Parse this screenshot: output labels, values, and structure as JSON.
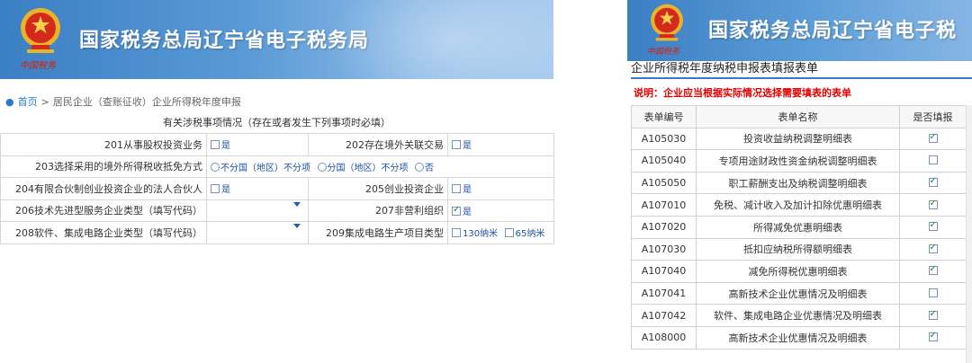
{
  "left": {
    "site_title": "国家税务总局辽宁省电子税务局",
    "calligraphy": "中国税务",
    "breadcrumb": {
      "home": "首页",
      "separator": ">",
      "path": "居民企业（查账征收）企业所得税年度申报"
    },
    "section_title": "有关涉税事项情况（存在或者发生下列事项时必填）",
    "rows": [
      {
        "l1": "201从事股权投资业务",
        "v1": "是",
        "l2": "202存在境外关联交易",
        "v2": "是"
      },
      {
        "l1": "203选择采用的境外所得税收抵免方式",
        "opt1": "不分国（地区）不分项",
        "opt2": "分国（地区）不分项",
        "opt3": "否"
      },
      {
        "l1": "204有限合伙制创业投资企业的法人合伙人",
        "v1": "是",
        "l2": "205创业投资企业",
        "v2": "是"
      },
      {
        "l1": "206技术先进型服务企业类型（填写代码）",
        "l2": "207非营利组织",
        "v2": "是"
      },
      {
        "l1": "208软件、集成电路企业类型（填写代码）",
        "l2": "209集成电路生产项目类型",
        "v2a": "130纳米",
        "v2b": "65纳米"
      }
    ]
  },
  "right": {
    "site_title": "国家税务总局辽宁省电子税",
    "calligraphy": "中国税务",
    "title": "企业所得税年度纳税申报表填报表单",
    "note": "说明：企业应当根据实际情况选择需要填表的表单",
    "headers": {
      "code": "表单编号",
      "name": "表单名称",
      "fill": "是否填报"
    },
    "rows": [
      {
        "code": "A105030",
        "name": "投资收益纳税调整明细表",
        "checked": true
      },
      {
        "code": "A105040",
        "name": "专项用途财政性资金纳税调整明细表",
        "checked": false
      },
      {
        "code": "A105050",
        "name": "职工薪酬支出及纳税调整明细表",
        "checked": true
      },
      {
        "code": "A107010",
        "name": "免税、减计收入及加计扣除优惠明细表",
        "checked": true
      },
      {
        "code": "A107020",
        "name": "所得减免优惠明细表",
        "checked": true
      },
      {
        "code": "A107030",
        "name": "抵扣应纳税所得额明细表",
        "checked": true
      },
      {
        "code": "A107040",
        "name": "减免所得税优惠明细表",
        "checked": true
      },
      {
        "code": "A107041",
        "name": "高新技术企业优惠情况及明细表",
        "checked": false
      },
      {
        "code": "A107042",
        "name": "软件、集成电路企业优惠情况及明细表",
        "checked": true
      },
      {
        "code": "A108000",
        "name": "高新技术企业优惠情况及明细表",
        "checked": true
      }
    ]
  },
  "colors": {
    "banner_blue": "#3b7fc4",
    "link_blue": "#2a7ad0",
    "note_red": "#e00000",
    "check_green": "#1a8a2a"
  }
}
